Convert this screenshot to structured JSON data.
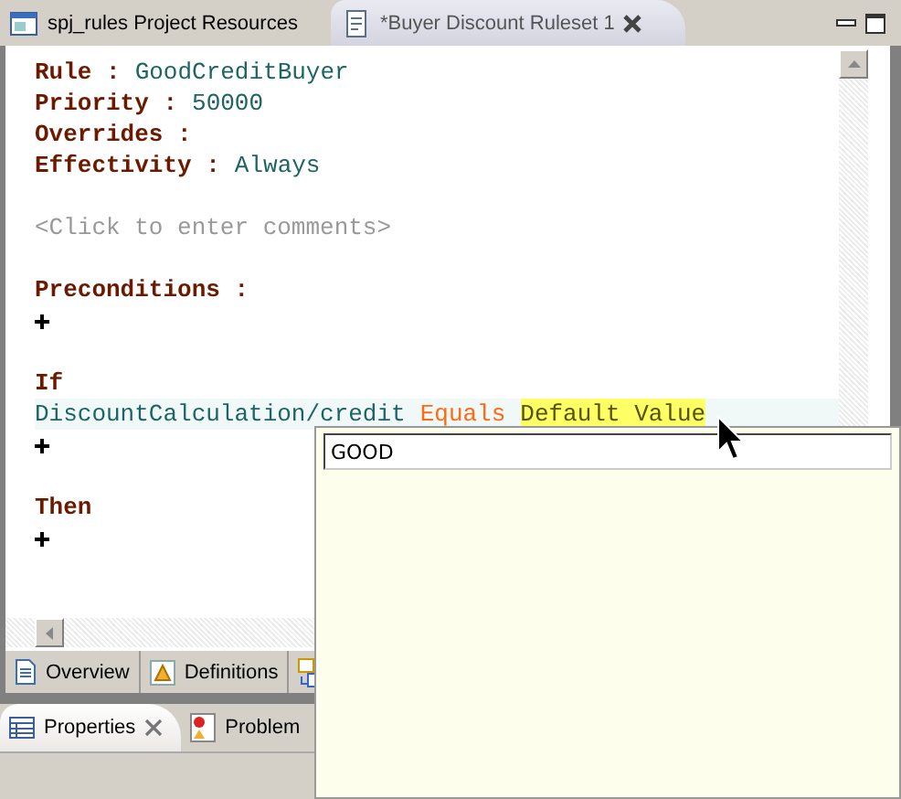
{
  "editor_tabs": [
    {
      "label": "spj_rules Project Resources",
      "selected": false
    },
    {
      "label": "*Buyer Discount Ruleset 1",
      "selected": true
    }
  ],
  "lines": [
    {
      "kind": "field",
      "label": "Rule :",
      "value": "GoodCreditBuyer"
    },
    {
      "kind": "field",
      "label": "Priority :",
      "value": "50000"
    },
    {
      "kind": "field",
      "label": "Overrides :"
    },
    {
      "kind": "field",
      "label": "Effectivity :",
      "value": "Always"
    },
    {
      "kind": "blank"
    },
    {
      "kind": "comment",
      "text": "<Click to enter comments>"
    },
    {
      "kind": "blank"
    },
    {
      "kind": "heading",
      "text": "Preconditions :"
    },
    {
      "kind": "add"
    },
    {
      "kind": "blank"
    },
    {
      "kind": "heading",
      "text": "If"
    },
    {
      "kind": "condition",
      "subject": "DiscountCalculation/credit",
      "operator": "Equals",
      "value": "Default Value",
      "highlighted": true
    },
    {
      "kind": "add"
    },
    {
      "kind": "blank"
    },
    {
      "kind": "heading",
      "text": "Then"
    },
    {
      "kind": "add"
    }
  ],
  "page_tabs": [
    {
      "kind": "document",
      "label": "Overview"
    },
    {
      "kind": "warning",
      "label": "Definitions"
    },
    {
      "kind": "swap"
    }
  ],
  "view_tabs": [
    {
      "label": "Properties",
      "selected": true
    },
    {
      "label": "Problem",
      "selected": false
    }
  ],
  "popup": {
    "value": "GOOD"
  }
}
